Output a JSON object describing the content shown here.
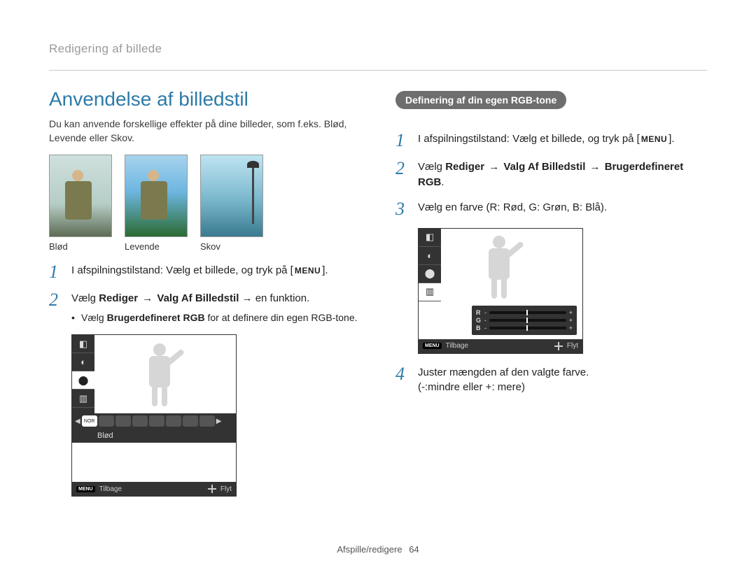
{
  "breadcrumb": "Redigering af billede",
  "title": "Anvendelse af billedstil",
  "intro": "Du kan anvende forskellige effekter på dine billeder, som f.eks. Blød, Levende  eller Skov.",
  "thumbs": {
    "soft": "Blød",
    "vivid": "Levende",
    "forest": "Skov"
  },
  "menu_label": "MENU",
  "left_steps": {
    "s1": "I afspilningstilstand: Vælg et billede, og tryk på [",
    "s1_end": "].",
    "s2_pre": "Vælg ",
    "s2_b1": "Rediger",
    "s2_arrow": " → ",
    "s2_b2": "Valg Af Billedstil",
    "s2_post": " → en funktion.",
    "s2_sub_pre": "Vælg ",
    "s2_sub_b": "Brugerdefineret RGB",
    "s2_sub_post": " for at definere din egen RGB-tone."
  },
  "left_cam": {
    "chips": [
      "NOR",
      "",
      "",
      "",
      "",
      "",
      "",
      "",
      ""
    ],
    "label": "Blød",
    "back_tag": "MENU",
    "back": "Tilbage",
    "move": "Flyt"
  },
  "pill": "Definering af din egen RGB-tone",
  "right_steps": {
    "s1": "I afspilningstilstand: Vælg et billede, og tryk på [",
    "s1_end": "].",
    "s2_pre": "Vælg ",
    "s2_b1": "Rediger",
    "s2_arrow": " → ",
    "s2_b2": "Valg Af Billedstil",
    "s2_arrow2": " → ",
    "s2_b3": "Brugerdefineret RGB",
    "s2_post": ".",
    "s3": "Vælg en farve (R: Rød, G: Grøn, B: Blå).",
    "s4a": "Juster mængden af den valgte farve.",
    "s4b": "(-:mindre eller +: mere)"
  },
  "right_cam": {
    "rgb": {
      "r": "R",
      "g": "G",
      "b": "B",
      "minus": "-",
      "plus": "+"
    },
    "back_tag": "MENU",
    "back": "Tilbage",
    "move": "Flyt"
  },
  "footer_section": "Afspille/redigere",
  "footer_page": "64"
}
